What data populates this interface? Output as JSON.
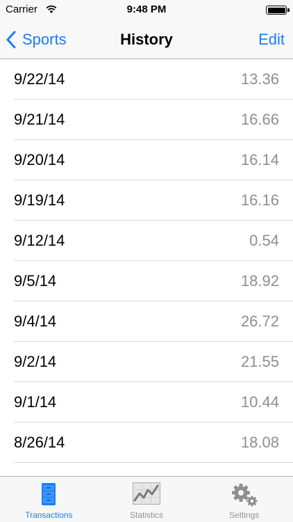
{
  "status_bar": {
    "carrier": "Carrier",
    "time": "9:48 PM"
  },
  "nav": {
    "back_label": "Sports",
    "title": "History",
    "edit_label": "Edit"
  },
  "rows": [
    {
      "date": "9/22/14",
      "amount": "13.36"
    },
    {
      "date": "9/21/14",
      "amount": "16.66"
    },
    {
      "date": "9/20/14",
      "amount": "16.14"
    },
    {
      "date": "9/19/14",
      "amount": "16.16"
    },
    {
      "date": "9/12/14",
      "amount": "0.54"
    },
    {
      "date": "9/5/14",
      "amount": "18.92"
    },
    {
      "date": "9/4/14",
      "amount": "26.72"
    },
    {
      "date": "9/2/14",
      "amount": "21.55"
    },
    {
      "date": "9/1/14",
      "amount": "10.44"
    },
    {
      "date": "8/26/14",
      "amount": "18.08"
    },
    {
      "date": "",
      "amount": ""
    }
  ],
  "tabs": [
    {
      "label": "Transactions",
      "icon": "file-cabinet-icon",
      "active": true
    },
    {
      "label": "Statistics",
      "icon": "chart-icon",
      "active": false
    },
    {
      "label": "Settings",
      "icon": "gear-icon",
      "active": false
    }
  ],
  "colors": {
    "accent": "#157efb",
    "inactive": "#929292",
    "amount": "#8e8e93"
  }
}
